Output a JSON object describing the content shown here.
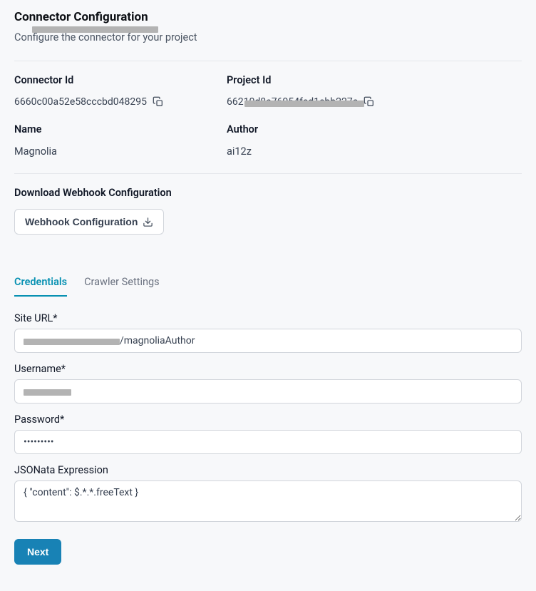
{
  "header": {
    "title": "Connector Configuration",
    "subtitle": "Configure the connector for your project"
  },
  "info": {
    "connector_id_label": "Connector Id",
    "connector_id_value": "6660c00a52e58cccbd048295",
    "project_id_label": "Project Id",
    "project_id_value": "66210d8a76954fed1ebb227a",
    "name_label": "Name",
    "name_value": "Magnolia",
    "author_label": "Author",
    "author_value": "ai12z"
  },
  "webhook": {
    "section_label": "Download Webhook Configuration",
    "button_label": "Webhook Configuration"
  },
  "tabs": {
    "credentials": "Credentials",
    "crawler": "Crawler Settings"
  },
  "form": {
    "site_url_label": "Site URL*",
    "site_url_value_suffix": "/magnoliaAuthor",
    "username_label": "Username*",
    "username_value": "",
    "password_label": "Password*",
    "password_value": "•••••••••",
    "jsonata_label": "JSONata Expression",
    "jsonata_value": "{ \"content\": $.*.*.freeText }",
    "next_label": "Next"
  }
}
